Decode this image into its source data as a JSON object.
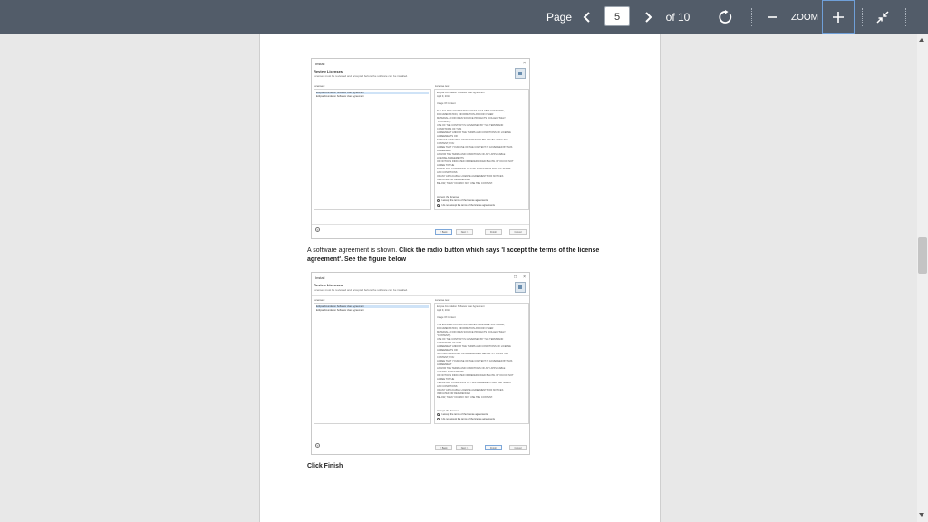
{
  "toolbar": {
    "page_label": "Page",
    "current_page": "5",
    "total_pages": "of 10",
    "zoom_label": "ZOOM"
  },
  "document": {
    "caption_1_lead": "A software agreement is shown. ",
    "caption_1_bold": "Click the radio button which says 'I accept the terms of the license agreement'. See the figure below",
    "caption_2": "Click Finish"
  },
  "shot1": {
    "window_title": "Install",
    "heading": "Review Licenses",
    "subheading": "Licenses must be reviewed and accepted before the software can be installed.",
    "licenses_label": "Licenses:",
    "license_text_label": "License text:",
    "license_items": [
      "Eclipse Foundation Software User Agreement",
      "Eclipse Foundation Software User Agreement"
    ],
    "license_text_lines": [
      "Eclipse Foundation Software User Agreement",
      "April 9, 2014",
      "",
      "Usage Of Content",
      "",
      "THE ECLIPSE FOUNDATION MAKES AVAILABLE SOFTWARE,",
      "DOCUMENTATION, INFORMATION AND/OR OTHER",
      "MATERIALS FOR OPEN SOURCE PROJECTS (COLLECTIVELY",
      "\"CONTENT\").",
      "USE OF THE CONTENT IS GOVERNED BY THE TERMS AND",
      "CONDITIONS OF THIS",
      "AGREEMENT AND/OR THE TERMS AND CONDITIONS OF LICENSE",
      "AGREEMENTS OR",
      "NOTICES INDICATED OR REFERENCED BELOW. BY USING THE",
      "CONTENT, YOU",
      "AGREE THAT YOUR USE OF THE CONTENT IS GOVERNED BY THIS",
      "AGREEMENT",
      "AND/OR THE TERMS AND CONDITIONS OF ANY APPLICABLE",
      "LICENSE AGREEMENTS",
      "OR NOTICES INDICATED OR REFERENCED BELOW. IF YOU DO NOT",
      "AGREE TO THE",
      "TERMS AND CONDITIONS OF THIS AGREEMENT AND THE TERMS",
      "AND CONDITIONS",
      "OF ANY APPLICABLE LICENSE AGREEMENTS OR NOTICES",
      "INDICATED OR REFERENCED",
      "BELOW, THEN YOU MAY NOT USE THE CONTENT."
    ],
    "accept_prompt": "Accept the license:",
    "accept_option": "I accept the terms of the license agreements",
    "decline_option": "I do not accept the terms of the license agreements",
    "help": "?",
    "back": "< Back",
    "next": "Next >",
    "finish": "Finish",
    "cancel": "Cancel"
  },
  "shot2": {
    "window_title": "Install",
    "heading": "Review Licenses",
    "subheading": "Licenses must be reviewed and accepted before the software can be installed.",
    "licenses_label": "Licenses:",
    "license_text_label": "License text:",
    "license_items": [
      "Eclipse Foundation Software User Agreement",
      "Eclipse Foundation Software User Agreement"
    ],
    "license_text_lines": [
      "Eclipse Foundation Software User Agreement",
      "April 9, 2014",
      "",
      "Usage Of Content",
      "",
      "THE ECLIPSE FOUNDATION MAKES AVAILABLE SOFTWARE,",
      "DOCUMENTATION, INFORMATION AND/OR OTHER",
      "MATERIALS FOR OPEN SOURCE PROJECTS (COLLECTIVELY",
      "\"CONTENT\").",
      "USE OF THE CONTENT IS GOVERNED BY THE TERMS AND",
      "CONDITIONS OF THIS",
      "AGREEMENT AND/OR THE TERMS AND CONDITIONS OF LICENSE",
      "AGREEMENTS OR",
      "NOTICES INDICATED OR REFERENCED BELOW. BY USING THE",
      "CONTENT, YOU",
      "AGREE THAT YOUR USE OF THE CONTENT IS GOVERNED BY THIS",
      "AGREEMENT",
      "AND/OR THE TERMS AND CONDITIONS OF ANY APPLICABLE",
      "LICENSE AGREEMENTS",
      "OR NOTICES INDICATED OR REFERENCED BELOW. IF YOU DO NOT",
      "AGREE TO THE",
      "TERMS AND CONDITIONS OF THIS AGREEMENT AND THE TERMS",
      "AND CONDITIONS",
      "OF ANY APPLICABLE LICENSE AGREEMENTS OR NOTICES",
      "INDICATED OR REFERENCED",
      "BELOW, THEN YOU MAY NOT USE THE CONTENT."
    ],
    "accept_prompt": "Accept the license:",
    "accept_option": "I accept the terms of the license agreements",
    "decline_option": "I do not accept the terms of the license agreements",
    "help": "?",
    "back": "< Back",
    "next": "Next >",
    "finish": "Finish",
    "cancel": "Cancel"
  }
}
